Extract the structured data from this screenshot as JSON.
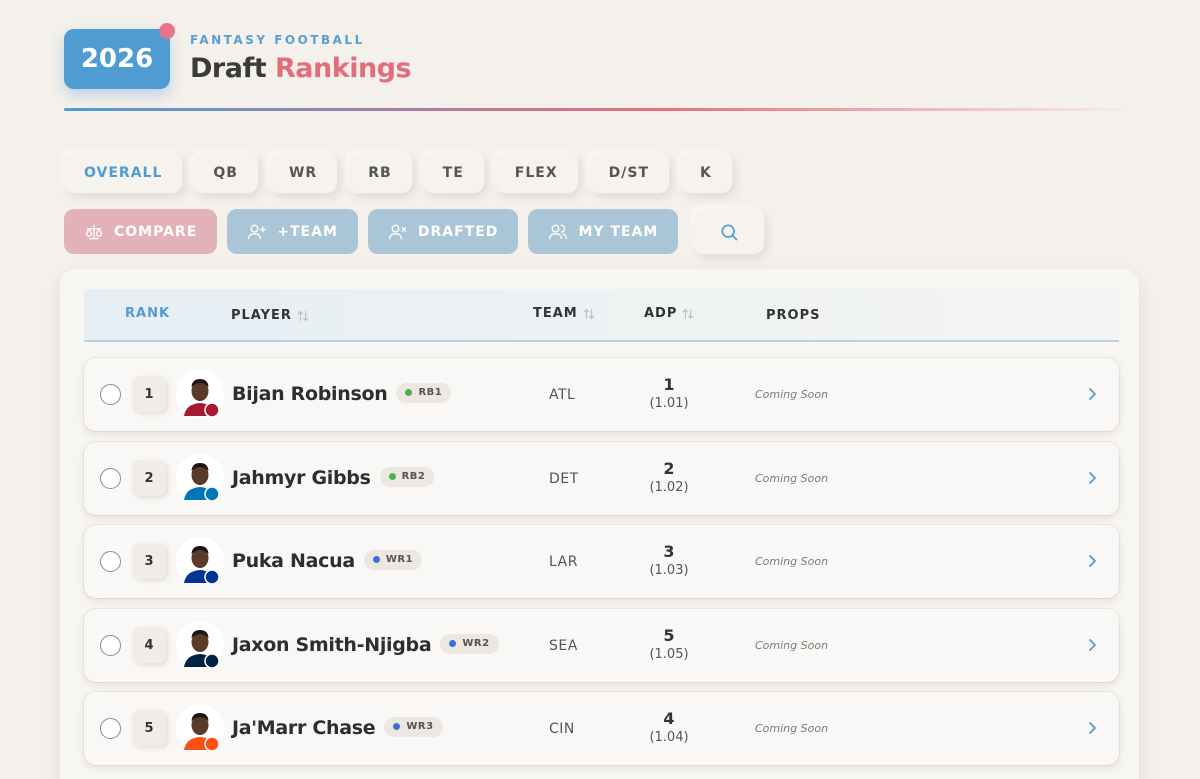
{
  "header": {
    "year": "2026",
    "eyebrow": "FANTASY FOOTBALL",
    "title_main": "Draft",
    "title_accent": "Rankings"
  },
  "position_tabs": [
    "OVERALL",
    "QB",
    "WR",
    "RB",
    "TE",
    "FLEX",
    "D/ST",
    "K"
  ],
  "active_tab": "OVERALL",
  "actions": {
    "compare": "COMPARE",
    "add_team": "+TEAM",
    "drafted": "DRAFTED",
    "my_team": "MY TEAM",
    "search_icon": "search-icon"
  },
  "table": {
    "columns": {
      "rank": "RANK",
      "player": "PLAYER",
      "team": "TEAM",
      "adp": "ADP",
      "props": "PROPS"
    },
    "rows": [
      {
        "rank": "1",
        "name": "Bijan Robinson",
        "pos": "RB1",
        "pos_color": "#4caf50",
        "team": "ATL",
        "adp": "1",
        "adp_pick": "(1.01)",
        "props": "Coming Soon",
        "helmet": "#a71930"
      },
      {
        "rank": "2",
        "name": "Jahmyr Gibbs",
        "pos": "RB2",
        "pos_color": "#4caf50",
        "team": "DET",
        "adp": "2",
        "adp_pick": "(1.02)",
        "props": "Coming Soon",
        "helmet": "#0076b6"
      },
      {
        "rank": "3",
        "name": "Puka Nacua",
        "pos": "WR1",
        "pos_color": "#3b6fd8",
        "team": "LAR",
        "adp": "3",
        "adp_pick": "(1.03)",
        "props": "Coming Soon",
        "helmet": "#003594"
      },
      {
        "rank": "4",
        "name": "Jaxon Smith-Njigba",
        "pos": "WR2",
        "pos_color": "#3b6fd8",
        "team": "SEA",
        "adp": "5",
        "adp_pick": "(1.05)",
        "props": "Coming Soon",
        "helmet": "#002244"
      },
      {
        "rank": "5",
        "name": "Ja'Marr Chase",
        "pos": "WR3",
        "pos_color": "#3b6fd8",
        "team": "CIN",
        "adp": "4",
        "adp_pick": "(1.04)",
        "props": "Coming Soon",
        "helmet": "#fb4f14"
      }
    ]
  },
  "colors": {
    "accent_blue": "#4f9cd2",
    "accent_pink": "#e46d7c",
    "background": "#f4f0eb"
  }
}
